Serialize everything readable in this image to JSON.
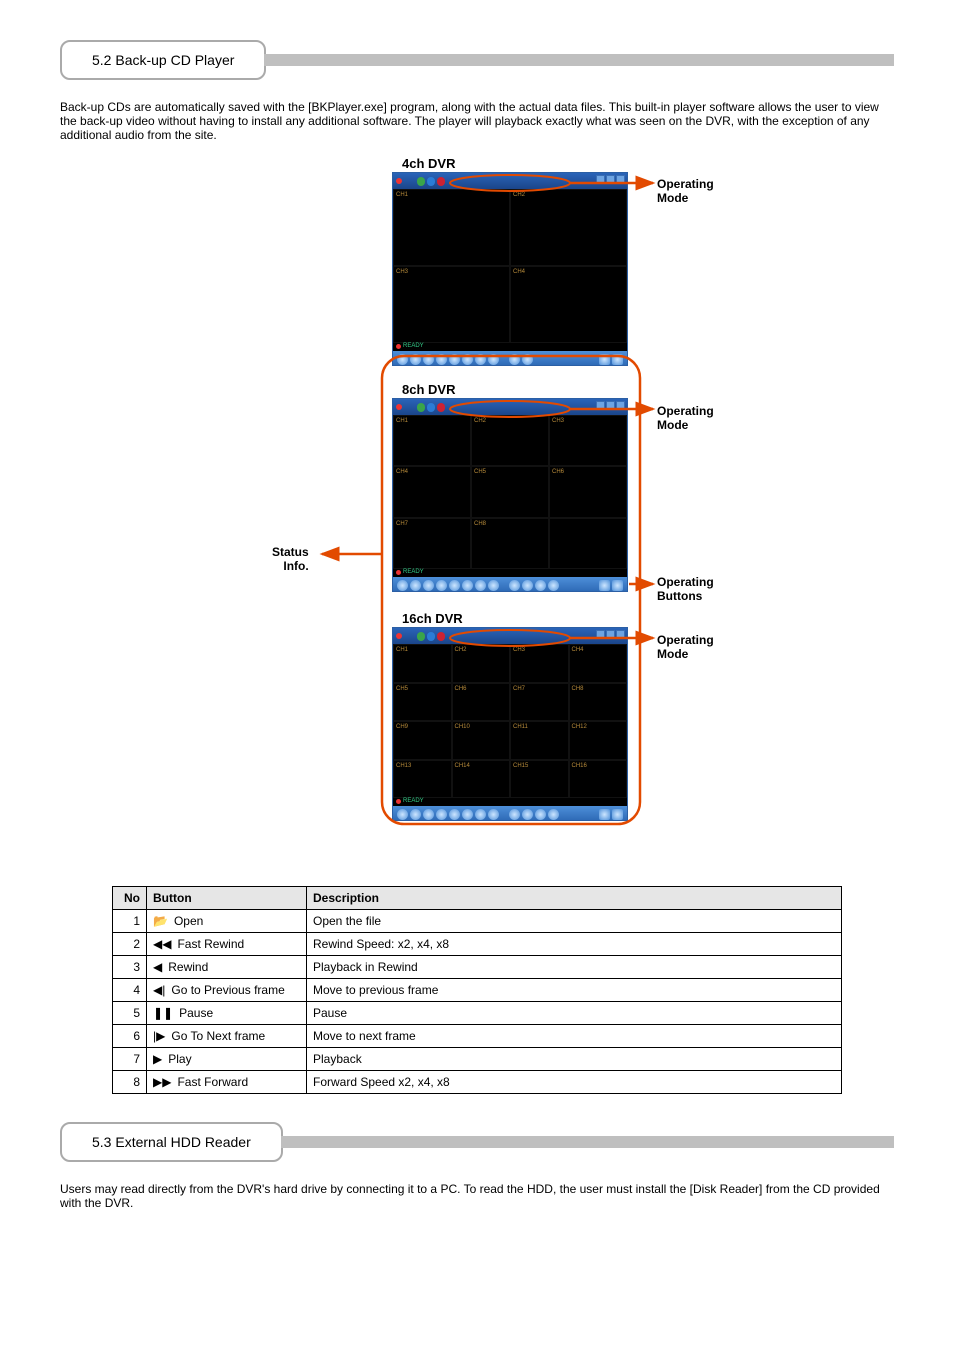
{
  "section1": {
    "title": "5.2 Back-up CD Player"
  },
  "intro": "Back-up CDs are automatically saved with the [BKPlayer.exe] program, along with the actual data files. This built-in player software allows the user to view the back-up video without having to install any additional software. The player will playback exactly what was seen on the DVR, with the exception of any additional audio from the site.",
  "figure": {
    "shot1_title": "4ch DVR",
    "shot2_title": "8ch DVR",
    "shot3_title": "16ch DVR",
    "anno_status": "Status\nInfo.",
    "anno_mode": "Operating\nMode",
    "anno_buttons": "Operating\nButtons",
    "channels4": [
      "CH1",
      "CH2",
      "CH3",
      "CH4"
    ],
    "channels8": [
      "CH1",
      "CH2",
      "CH3",
      "CH4",
      "CH5",
      "CH6",
      "CH7",
      "CH8"
    ],
    "channels16": [
      "CH1",
      "CH2",
      "CH3",
      "CH4",
      "CH5",
      "CH6",
      "CH7",
      "CH8",
      "CH9",
      "CH10",
      "CH11",
      "CH12",
      "CH13",
      "CH14",
      "CH15",
      "CH16"
    ],
    "status_text": "READY"
  },
  "table": {
    "head_no": "No",
    "head_button": "Button",
    "head_desc": "Description",
    "rows": [
      {
        "no": "1",
        "icon": "folder-open-icon",
        "label": "Open",
        "glyph": "📂",
        "desc": "Open the file"
      },
      {
        "no": "2",
        "icon": "fast-rewind-icon",
        "label": "Fast Rewind",
        "glyph": "◀◀",
        "desc": "Rewind Speed: x2, x4, x8"
      },
      {
        "no": "3",
        "icon": "rewind-icon",
        "label": "Rewind",
        "glyph": "◀",
        "desc": "Playback in Rewind"
      },
      {
        "no": "4",
        "icon": "prev-frame-icon",
        "label": "Go to Previous frame",
        "glyph": "◀|",
        "desc": "Move to previous frame"
      },
      {
        "no": "5",
        "icon": "pause-icon",
        "label": "Pause",
        "glyph": "❚❚",
        "desc": "Pause"
      },
      {
        "no": "6",
        "icon": "next-frame-icon",
        "label": "Go To Next frame",
        "glyph": "|▶",
        "desc": "Move to next frame"
      },
      {
        "no": "7",
        "icon": "play-icon",
        "label": "Play",
        "glyph": "▶",
        "desc": "Playback"
      },
      {
        "no": "8",
        "icon": "fast-forward-icon",
        "label": "Fast Forward",
        "glyph": "▶▶",
        "desc": "Forward Speed x2, x4, x8"
      }
    ]
  },
  "section2": {
    "title": "5.3 External HDD Reader"
  },
  "outro": "Users may read directly from the DVR's hard drive by connecting it to a PC. To read the HDD, the user must install the [Disk Reader] from the CD provided with the DVR."
}
